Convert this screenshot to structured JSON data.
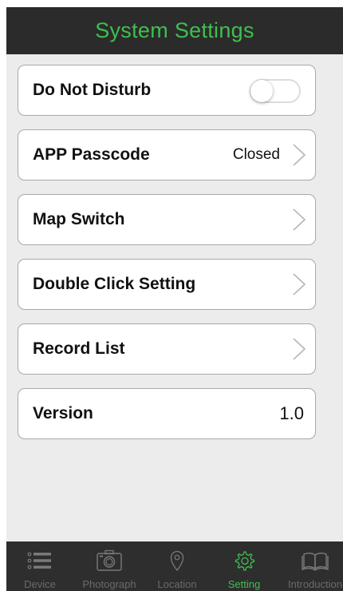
{
  "header": {
    "title": "System Settings"
  },
  "rows": [
    {
      "label": "Do Not Disturb",
      "toggle": false
    },
    {
      "label": "APP Passcode",
      "value": "Closed"
    },
    {
      "label": "Map Switch"
    },
    {
      "label": "Double Click Setting"
    },
    {
      "label": "Record List"
    },
    {
      "label": "Version",
      "value": "1.0"
    }
  ],
  "tabbar": {
    "active": "Setting",
    "active_color": "#3fbf4f",
    "tabs": [
      {
        "label": "Device",
        "icon": "list-icon"
      },
      {
        "label": "Photograph",
        "icon": "camera-icon"
      },
      {
        "label": "Location",
        "icon": "location-pin-icon"
      },
      {
        "label": "Setting",
        "icon": "gear-icon"
      },
      {
        "label": "Introduction",
        "icon": "book-icon"
      }
    ]
  }
}
